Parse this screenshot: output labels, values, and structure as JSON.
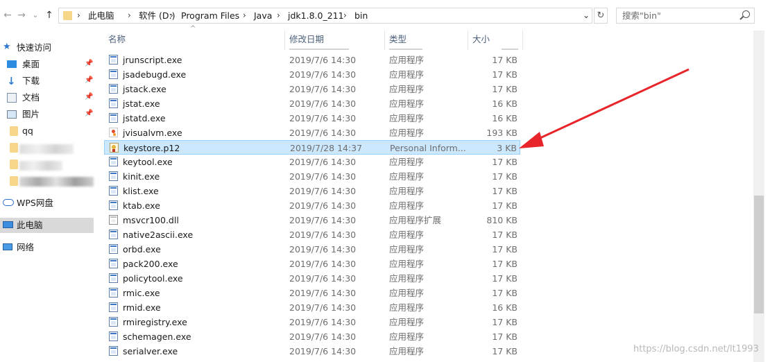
{
  "toolbar": {
    "back": "←",
    "forward": "→",
    "dropdown": "⌄",
    "up": "↑"
  },
  "address": {
    "segments": [
      "此电脑",
      "软件 (D:)",
      "Program Files",
      "Java",
      "jdk1.8.0_211",
      "bin"
    ],
    "separator": "›",
    "dropdown": "⌄"
  },
  "refresh": "↻",
  "search": {
    "placeholder": "搜索\"bin\""
  },
  "sidebar": {
    "items": [
      {
        "label": "快速访问",
        "icon": "star-icon"
      },
      {
        "label": "桌面",
        "icon": "desktop-icon",
        "pinned": true
      },
      {
        "label": "下载",
        "icon": "download-icon",
        "pinned": true
      },
      {
        "label": "文档",
        "icon": "documents-icon",
        "pinned": true
      },
      {
        "label": "图片",
        "icon": "pictures-icon",
        "pinned": true
      },
      {
        "label": "qq",
        "icon": "folder-icon"
      },
      {
        "label": "WPS网盘",
        "icon": "cloud-icon"
      },
      {
        "label": "此电脑",
        "icon": "computer-icon",
        "selected": true
      },
      {
        "label": "网络",
        "icon": "network-icon"
      }
    ],
    "pin_glyph": "📌"
  },
  "columns": {
    "name": "名称",
    "date": "修改日期",
    "type": "类型",
    "size": "大小",
    "sort_arrow": "^"
  },
  "rows": [
    {
      "name": "jrunscript.exe",
      "date": "2019/7/6 14:30",
      "type": "应用程序",
      "size": "17 KB",
      "icon": "exe"
    },
    {
      "name": "jsadebugd.exe",
      "date": "2019/7/6 14:30",
      "type": "应用程序",
      "size": "17 KB",
      "icon": "exe"
    },
    {
      "name": "jstack.exe",
      "date": "2019/7/6 14:30",
      "type": "应用程序",
      "size": "17 KB",
      "icon": "exe"
    },
    {
      "name": "jstat.exe",
      "date": "2019/7/6 14:30",
      "type": "应用程序",
      "size": "16 KB",
      "icon": "exe"
    },
    {
      "name": "jstatd.exe",
      "date": "2019/7/6 14:30",
      "type": "应用程序",
      "size": "16 KB",
      "icon": "exe"
    },
    {
      "name": "jvisualvm.exe",
      "date": "2019/7/6 14:30",
      "type": "应用程序",
      "size": "193 KB",
      "icon": "java"
    },
    {
      "name": "keystore.p12",
      "date": "2019/7/28 14:37",
      "type": "Personal Inform...",
      "size": "3 KB",
      "icon": "cert",
      "selected": true
    },
    {
      "name": "keytool.exe",
      "date": "2019/7/6 14:30",
      "type": "应用程序",
      "size": "17 KB",
      "icon": "exe"
    },
    {
      "name": "kinit.exe",
      "date": "2019/7/6 14:30",
      "type": "应用程序",
      "size": "17 KB",
      "icon": "exe"
    },
    {
      "name": "klist.exe",
      "date": "2019/7/6 14:30",
      "type": "应用程序",
      "size": "17 KB",
      "icon": "exe"
    },
    {
      "name": "ktab.exe",
      "date": "2019/7/6 14:30",
      "type": "应用程序",
      "size": "17 KB",
      "icon": "exe"
    },
    {
      "name": "msvcr100.dll",
      "date": "2019/7/6 14:30",
      "type": "应用程序扩展",
      "size": "810 KB",
      "icon": "dll"
    },
    {
      "name": "native2ascii.exe",
      "date": "2019/7/6 14:30",
      "type": "应用程序",
      "size": "17 KB",
      "icon": "exe"
    },
    {
      "name": "orbd.exe",
      "date": "2019/7/6 14:30",
      "type": "应用程序",
      "size": "17 KB",
      "icon": "exe"
    },
    {
      "name": "pack200.exe",
      "date": "2019/7/6 14:30",
      "type": "应用程序",
      "size": "17 KB",
      "icon": "exe"
    },
    {
      "name": "policytool.exe",
      "date": "2019/7/6 14:30",
      "type": "应用程序",
      "size": "17 KB",
      "icon": "exe"
    },
    {
      "name": "rmic.exe",
      "date": "2019/7/6 14:30",
      "type": "应用程序",
      "size": "17 KB",
      "icon": "exe"
    },
    {
      "name": "rmid.exe",
      "date": "2019/7/6 14:30",
      "type": "应用程序",
      "size": "16 KB",
      "icon": "exe"
    },
    {
      "name": "rmiregistry.exe",
      "date": "2019/7/6 14:30",
      "type": "应用程序",
      "size": "17 KB",
      "icon": "exe"
    },
    {
      "name": "schemagen.exe",
      "date": "2019/7/6 14:30",
      "type": "应用程序",
      "size": "17 KB",
      "icon": "exe"
    },
    {
      "name": "serialver.exe",
      "date": "2019/7/6 14:30",
      "type": "应用程序",
      "size": "17 KB",
      "icon": "exe"
    }
  ],
  "colors": {
    "selection": "#cce8ff",
    "selection_border": "#99d1ff",
    "annotation_arrow": "#e8252b"
  },
  "annotation": {
    "type": "arrow",
    "points_to": "keystore.p12"
  },
  "watermark": "https://blog.csdn.net/lt1993"
}
